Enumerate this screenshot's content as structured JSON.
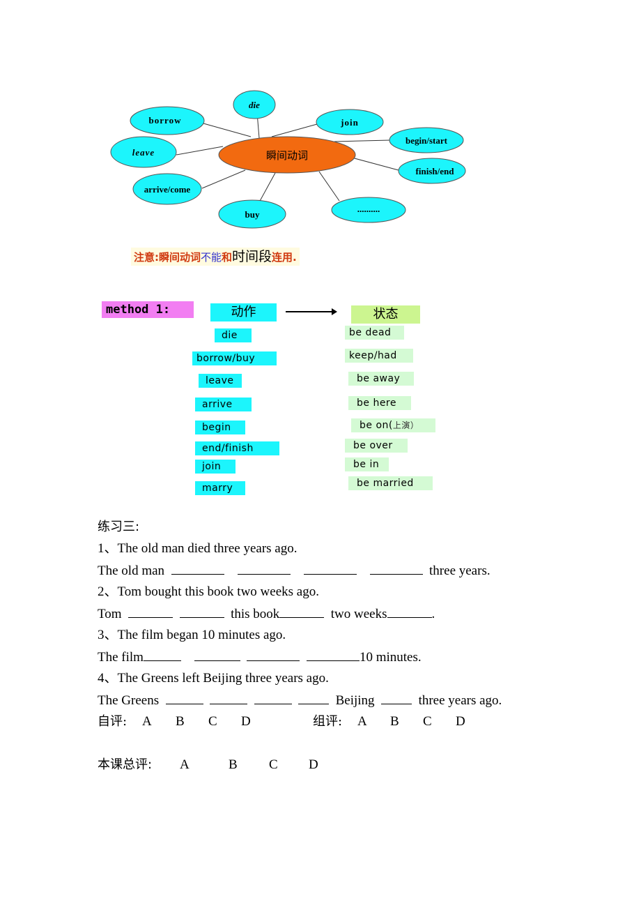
{
  "mindmap": {
    "center": "瞬间动词",
    "nodes": [
      "die",
      "borrow",
      "join",
      "begin/start",
      "leave",
      "finish/end",
      "arrive/come",
      "buy",
      ".........."
    ],
    "colors": {
      "node_fill": "#1cf5fc",
      "center_fill": "#f26a10"
    }
  },
  "note": {
    "part1": "注意:瞬间动词",
    "part2": "不能",
    "part3": "和",
    "part4": "时间段",
    "part5": "连用."
  },
  "method": {
    "label": "method 1:",
    "action_header": "动作",
    "state_header": "状态",
    "actions": [
      "die",
      "borrow/buy",
      "leave",
      "arrive",
      "begin",
      "end/finish",
      "join",
      "marry"
    ],
    "states": [
      "be dead",
      "keep/had",
      "be away",
      "be here",
      "be on(",
      "be over",
      "be in",
      "be married"
    ],
    "state_note": "上演）"
  },
  "exercise": {
    "title": "练习三:",
    "items": [
      {
        "q": "1、The old man died three years ago.",
        "a_prefix": "The old man",
        "a_suffix": "three years."
      },
      {
        "q": "2、Tom bought this book two weeks ago.",
        "a_prefix": "Tom",
        "a_mid1": "this book",
        "a_mid2": "two weeks",
        "a_suffix": "."
      },
      {
        "q": "3、The film began 10 minutes ago.",
        "a_prefix": "The film",
        "a_suffix": "10 minutes."
      },
      {
        "q": "4、The Greens left Beijing three years ago.",
        "a_prefix": "The Greens",
        "a_mid1": "Beijing",
        "a_suffix": "three years ago."
      }
    ]
  },
  "evaluation": {
    "self_label": "自评:",
    "group_label": "组评:",
    "overall_label": "本课总评:",
    "options": [
      "A",
      "B",
      "C",
      "D"
    ]
  }
}
